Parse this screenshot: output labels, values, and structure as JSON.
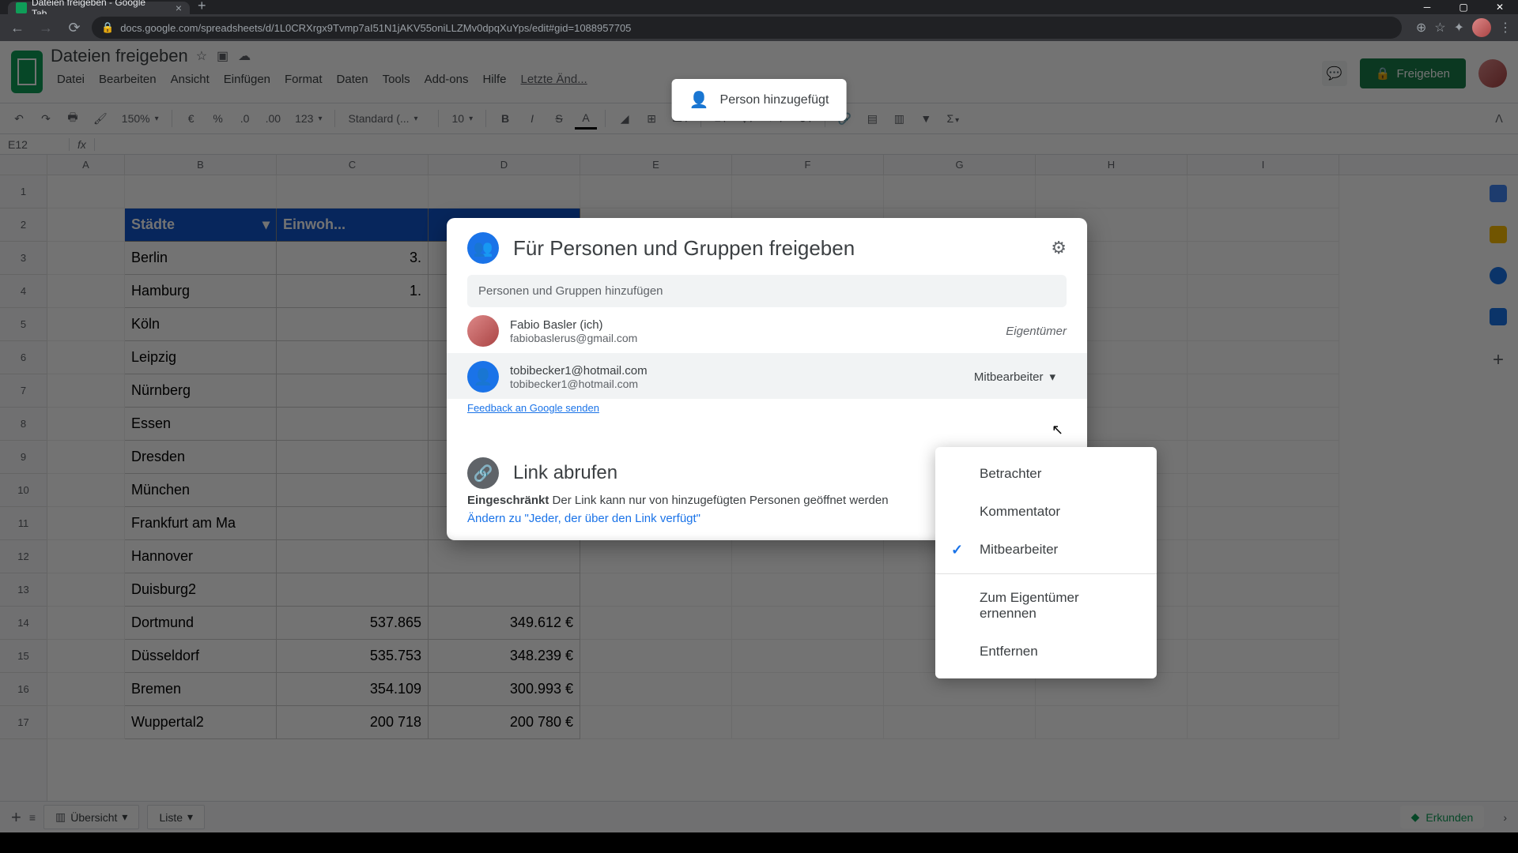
{
  "browser": {
    "tab_title": "Dateien freigeben - Google Tab...",
    "url": "docs.google.com/spreadsheets/d/1L0CRXrgx9Tvmp7aI51N1jAKV55oniLLZMv0dpqXuYps/edit#gid=1088957705"
  },
  "doc": {
    "title": "Dateien freigeben",
    "menus": [
      "Datei",
      "Bearbeiten",
      "Ansicht",
      "Einfügen",
      "Format",
      "Daten",
      "Tools",
      "Add-ons",
      "Hilfe",
      "Letzte Änd..."
    ],
    "share_button": "Freigeben"
  },
  "toolbar": {
    "zoom": "150%",
    "currency": "€",
    "percent": "%",
    "dec_dec": ".0",
    "dec_inc": ".00",
    "format": "123",
    "font": "Standard (...",
    "fontsize": "10"
  },
  "formula": {
    "cell": "E12"
  },
  "toast": {
    "text": "Person hinzugefügt"
  },
  "columns": [
    "A",
    "B",
    "C",
    "D",
    "E",
    "F",
    "G",
    "H",
    "I"
  ],
  "rows": [
    "1",
    "2",
    "3",
    "4",
    "5",
    "6",
    "7",
    "8",
    "9",
    "10",
    "11",
    "12",
    "13",
    "14",
    "15",
    "16",
    "17"
  ],
  "table": {
    "h1": "Städte",
    "h2": "Einwoh...",
    "cities": [
      "Berlin",
      "Hamburg",
      "Köln",
      "Leipzig",
      "Nürnberg",
      "Essen",
      "Dresden",
      "München",
      "Frankfurt am Ma",
      "Hannover",
      "Duisburg2",
      "Dortmund",
      "Düsseldorf",
      "Bremen",
      "Wuppertal2"
    ],
    "valsB": [
      "3.",
      "1.",
      "",
      "",
      "",
      "",
      "",
      "",
      "",
      "",
      "",
      "537.865",
      "535.753",
      "354.109",
      "200 718"
    ],
    "valsC": [
      "",
      "",
      "",
      "",
      "",
      "",
      "",
      "",
      "",
      "",
      "",
      "349.612 €",
      "348.239 €",
      "300.993 €",
      "200 780 €"
    ]
  },
  "share": {
    "title": "Für Personen und Gruppen freigeben",
    "placeholder": "Personen und Gruppen hinzufügen",
    "people": [
      {
        "name": "Fabio Basler (ich)",
        "email": "fabiobaslerus@gmail.com",
        "role": "Eigentümer"
      },
      {
        "name": "tobibecker1@hotmail.com",
        "email": "tobibecker1@hotmail.com",
        "role": "Mitbearbeiter"
      }
    ],
    "feedback": "Feedback an Google senden",
    "link_title": "Link abrufen",
    "restricted": "Eingeschränkt",
    "link_desc": " Der Link kann nur von hinzugefügten Personen geöffnet werden",
    "link_change": "Ändern zu \"Jeder, der über den Link verfügt\""
  },
  "role_menu": {
    "viewer": "Betrachter",
    "commenter": "Kommentator",
    "editor": "Mitbearbeiter",
    "make_owner": "Zum Eigentümer ernennen",
    "remove": "Entfernen"
  },
  "sheets": {
    "tab1": "Übersicht",
    "tab2": "Liste",
    "explore": "Erkunden"
  }
}
